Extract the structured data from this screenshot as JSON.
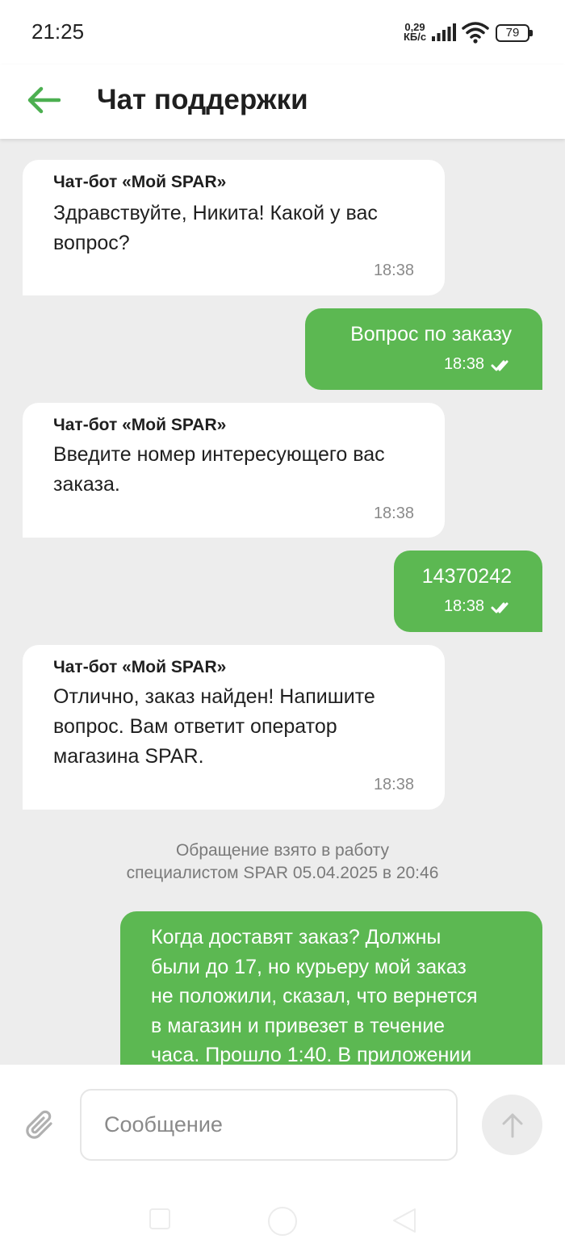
{
  "status_bar": {
    "time": "21:25",
    "net_speed_value": "0,29",
    "net_speed_unit": "КБ/с",
    "battery": "79"
  },
  "header": {
    "title": "Чат поддержки",
    "back_icon": "arrow-left-icon",
    "accent_color": "#4caf50"
  },
  "messages": [
    {
      "direction": "incoming",
      "sender": "Чат-бот «Мой SPAR»",
      "text": "Здравствуйте, Никита! Какой у вас\nвопрос?",
      "time": "18:38"
    },
    {
      "direction": "outgoing",
      "text": "Вопрос по заказу",
      "time": "18:38",
      "status": "read"
    },
    {
      "direction": "incoming",
      "sender": "Чат-бот «Мой SPAR»",
      "text": "Введите номер интересующего вас\nзаказа.",
      "time": "18:38"
    },
    {
      "direction": "outgoing",
      "text": "14370242",
      "time": "18:38",
      "status": "read"
    },
    {
      "direction": "incoming",
      "sender": "Чат-бот «Мой SPAR»",
      "text": "Отлично, заказ найден! Напишите\nвопрос. Вам ответит оператор\nмагазина SPAR.",
      "time": "18:38"
    },
    {
      "direction": "outgoing",
      "text": "Когда доставят заказ? Должны\nбыли до 17, но курьеру мой заказ\nне положили, сказал, что вернется\nв магазин и привезет в течение\nчаса. Прошло 1:40. В приложении"
    }
  ],
  "system_note": "Обращение взято в работу\nспециалистом SPAR 05.04.2025 в 20:46",
  "input": {
    "placeholder": "Сообщение",
    "value": "",
    "attach_icon": "paperclip-icon",
    "send_icon": "arrow-up-icon"
  },
  "colors": {
    "outgoing_bubble": "#5cb852",
    "incoming_bubble": "#ffffff",
    "chat_background": "#ededed"
  }
}
